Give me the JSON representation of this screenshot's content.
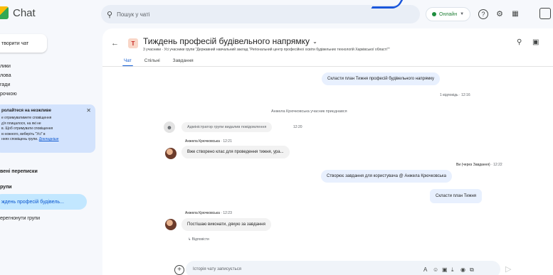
{
  "app": {
    "title": "Chat",
    "logo_icon": "google-chat-logo"
  },
  "search": {
    "placeholder": "Пошук у чаті"
  },
  "status": {
    "label": "Онлайн",
    "color": "#1e8e3e"
  },
  "sidebar": {
    "new_chat": "творити чат",
    "items": [
      {
        "label": "лики"
      },
      {
        "label": "лова"
      },
      {
        "label": "гади"
      },
      {
        "label": "рочкою"
      }
    ],
    "notice": {
      "title": "ролайтеся на незжливе",
      "lines": [
        "е отримуватимете сповіщення",
        "д'я плицалося, на які не",
        "в. Щоб отримувати сповіщення",
        "ю кожного, виберіть \"Усі\" в",
        "ннях сповіщень групи."
      ],
      "link": "Докладніше"
    },
    "direct_header": "вені переписки",
    "spaces_header": "рупи",
    "space_active": "ждень професій будівель...",
    "space_other": "ерегнонути групи"
  },
  "room": {
    "avatar_letter": "Т",
    "title": "Тиждень професій будівельного напрямку",
    "subtitle": "3 учасники · Усі учасники групи \"Державний навчальний заклад \"Регіональний центр професійної освіти будівельних технологій Харківської області\"\"",
    "tabs": [
      "Чат",
      "Спільні",
      "Завдання"
    ],
    "active_tab": 0
  },
  "messages": {
    "top_bubble": "Скласти план Тижня професій будівельного напрямку",
    "top_reply": "1 відповідь",
    "top_reply_time": "12:16",
    "joined": "Анжела Крючковська учасник приєднався",
    "admin_bubble": "Адміністратор групи видалив повідомлення",
    "admin_time": "12:20",
    "msg1_author": "Анжела Крючковська",
    "msg1_time": "12:21",
    "msg1_text": "Вже створено клас для проведення тижня, ура...",
    "msg2_meta": "Ви (через Завдання)",
    "msg2_time": "12:22",
    "msg2_text": "Створює завдання для користувача @ Анжела Крючковська",
    "msg2_card": "Скласти план Тижня",
    "msg3_author": "Анжела Крючковська",
    "msg3_time": "12:23",
    "msg3_text": "Постішаю виконати, дякую за завдання",
    "msg3_reply": "Відповісти"
  },
  "composer": {
    "placeholder": "Історія чату записується"
  },
  "colors": {
    "accent": "#0b57d0",
    "sidebar_active": "#c2e7ff",
    "notice_bg": "#d3e3fd"
  }
}
